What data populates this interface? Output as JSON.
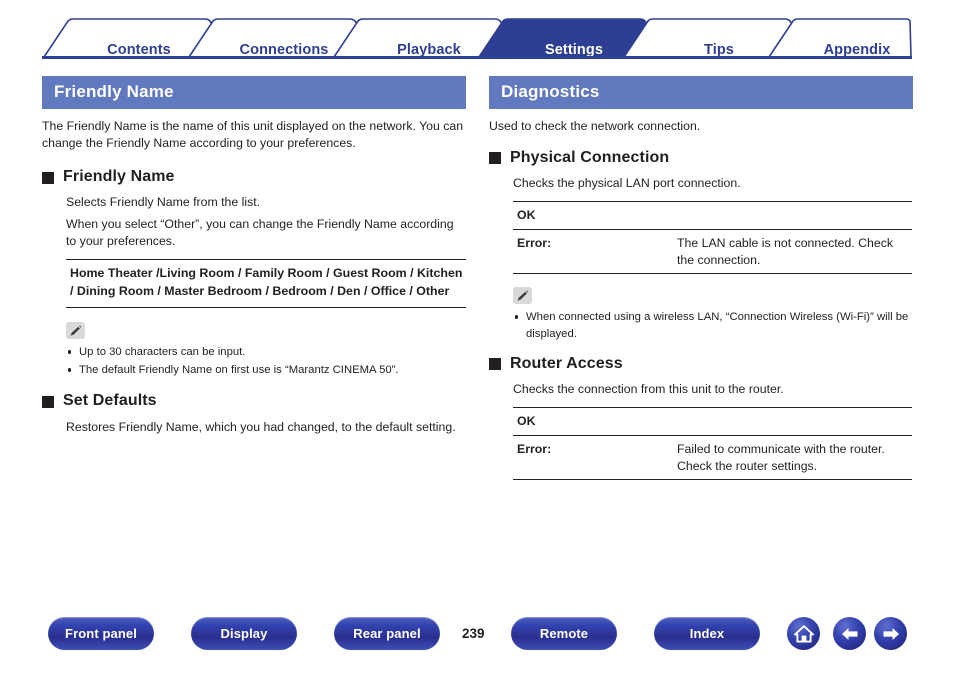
{
  "tabs": [
    {
      "label": "Contents",
      "active": false
    },
    {
      "label": "Connections",
      "active": false
    },
    {
      "label": "Playback",
      "active": false
    },
    {
      "label": "Settings",
      "active": true
    },
    {
      "label": "Tips",
      "active": false
    },
    {
      "label": "Appendix",
      "active": false
    }
  ],
  "colors": {
    "banner_blue": "#6179bf",
    "tab_navy": "#2e3e92",
    "button_blue": "#3142ae",
    "text": "#231f20"
  },
  "left": {
    "banner": "Friendly Name",
    "intro": "The Friendly Name is the name of this unit displayed on the network. You can change the Friendly Name according to your preferences.",
    "sections": [
      {
        "heading": "Friendly Name",
        "line1": "Selects Friendly Name from the list.",
        "line2": "When you select “Other”, you can change the Friendly Name according to your preferences.",
        "options": "Home Theater /Living Room / Family Room / Guest Room / Kitchen / Dining Room / Master Bedroom / Bedroom / Den / Office / Other",
        "note_icon": "pencil-icon",
        "notes": [
          "Up to 30 characters can be input.",
          "The default Friendly Name on first use is “Marantz CINEMA 50”."
        ]
      },
      {
        "heading": "Set Defaults",
        "body": "Restores Friendly Name, which you had changed, to the default setting."
      }
    ]
  },
  "right": {
    "banner": "Diagnostics",
    "intro": "Used to check the network connection.",
    "sections": [
      {
        "heading": "Physical Connection",
        "body": "Checks the physical LAN port connection.",
        "table": [
          {
            "label": "OK",
            "value": ""
          },
          {
            "label": "Error:",
            "value": "The LAN cable is not connected. Check the connection."
          }
        ],
        "note_icon": "pencil-icon",
        "notes": [
          "When connected using a wireless LAN, “Connection     Wireless (Wi-Fi)” will be displayed."
        ]
      },
      {
        "heading": "Router Access",
        "body": "Checks the connection from this unit to the router.",
        "table": [
          {
            "label": "OK",
            "value": ""
          },
          {
            "label": "Error:",
            "value": "Failed to communicate with the router. Check the router settings."
          }
        ]
      }
    ]
  },
  "footer": {
    "buttons": [
      {
        "label": "Front panel"
      },
      {
        "label": "Display"
      },
      {
        "label": "Rear panel"
      },
      {
        "label": "Remote"
      },
      {
        "label": "Index"
      }
    ],
    "page_number": "239",
    "icons": [
      {
        "name": "home-icon"
      },
      {
        "name": "arrow-left-icon"
      },
      {
        "name": "arrow-right-icon"
      }
    ]
  }
}
